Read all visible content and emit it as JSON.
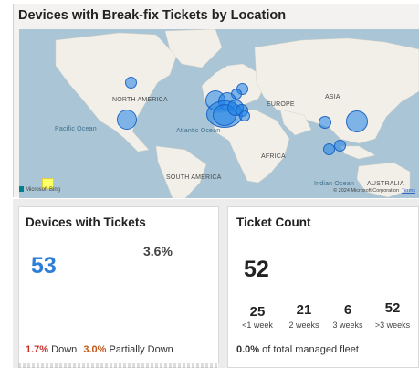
{
  "map": {
    "title": "Devices with Break-fix Tickets by Location",
    "labels": {
      "north_america": "NORTH AMERICA",
      "europe": "EUROPE",
      "asia": "ASIA",
      "africa": "AFRICA",
      "south_america": "SOUTH AMERICA",
      "australia": "AUSTRALIA",
      "pacific_ocean": "Pacific Ocean",
      "atlantic_ocean": "Atlantic Ocean",
      "indian_ocean": "Indian Ocean"
    },
    "attribution": "Microsoft Bing",
    "copyright": "© 2024 Microsoft Corporation",
    "terms": "Terms",
    "colors": {
      "water": "#a9c5d6",
      "land": "#f1efe8",
      "bubble": "#1e82e6"
    }
  },
  "devices_with_tickets": {
    "title": "Devices with Tickets",
    "count": "53",
    "percent": "3.6%",
    "down_pct": "1.7%",
    "down_label": "Down",
    "partially_down_pct": "3.0%",
    "partially_down_label": "Partially Down"
  },
  "ticket_count": {
    "title": "Ticket Count",
    "total": "52",
    "buckets": [
      {
        "value": "25",
        "label": "<1 week"
      },
      {
        "value": "21",
        "label": "2 weeks"
      },
      {
        "value": "6",
        "label": "3 weeks"
      },
      {
        "value": "52",
        "label": ">3 weeks"
      }
    ],
    "fleet_pct": "0.0%",
    "fleet_text": "of total managed fleet"
  }
}
